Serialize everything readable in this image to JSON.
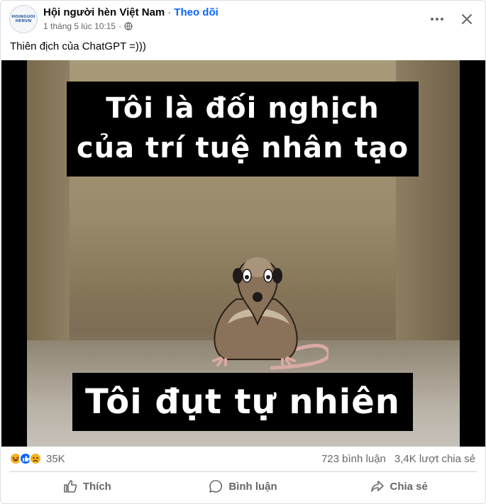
{
  "post": {
    "page_name": "Hội người hèn Việt Nam",
    "separator": "·",
    "follow_label": "Theo dõi",
    "timestamp": "1 tháng 5 lúc 10:15",
    "meta_dot": "·",
    "avatar_text_line1": "HOINGUOI",
    "avatar_text_line2": "HENVN",
    "text": "Thiên địch của ChatGPT =)))"
  },
  "image": {
    "caption_top_line1": "Tôi là đối nghịch",
    "caption_top_line2": "của trí tuệ nhân tạo",
    "caption_bottom": "Tôi đụt tự nhiên"
  },
  "reactions": {
    "types": [
      "haha",
      "like",
      "sad"
    ],
    "count": "35K",
    "comments": "723 bình luận",
    "shares": "3,4K lượt chia sẻ"
  },
  "actions": {
    "like_label": "Thích",
    "comment_label": "Bình luận",
    "share_label": "Chia sẻ"
  },
  "colors": {
    "accent": "#0866ff",
    "secondary_text": "#65676b"
  }
}
